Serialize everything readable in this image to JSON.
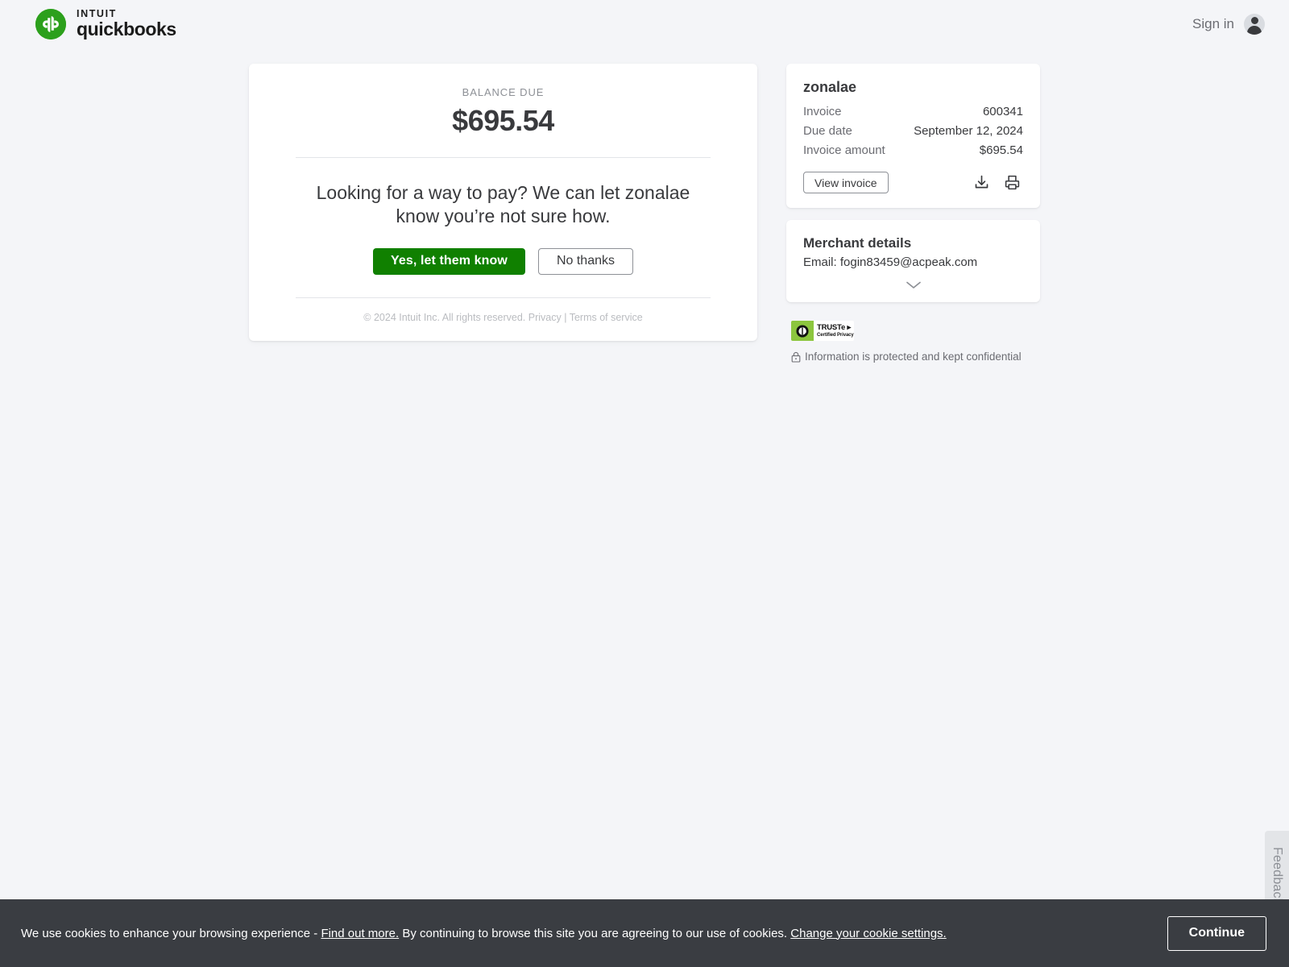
{
  "header": {
    "brand_intuit": "INTUIT",
    "brand_product": "quickbooks",
    "signin_label": "Sign in"
  },
  "main": {
    "balance_label": "BALANCE DUE",
    "balance_amount": "$695.54",
    "prompt": "Looking for a way to pay? We can let zonalae know you’re not sure how.",
    "primary_button": "Yes, let them know",
    "secondary_button": "No thanks",
    "legal_copyright": "© 2024 Intuit Inc. All rights reserved. ",
    "legal_privacy": "Privacy",
    "legal_separator": " | ",
    "legal_terms": "Terms of service"
  },
  "invoice_card": {
    "merchant_name": "zonalae",
    "rows": [
      {
        "label": "Invoice",
        "value": "600341"
      },
      {
        "label": "Due date",
        "value": "September 12, 2024"
      },
      {
        "label": "Invoice amount",
        "value": "$695.54"
      }
    ],
    "view_invoice_label": "View invoice",
    "download_icon": "download-icon",
    "print_icon": "printer-icon"
  },
  "merchant_card": {
    "title": "Merchant details",
    "email_line": "Email: fogin83459@acpeak.com",
    "expand_icon": "chevron-down-icon"
  },
  "trust": {
    "badge_main": "TRUSTe ▸",
    "badge_sub": "Certified Privacy",
    "protected_text": "Information is protected and kept confidential",
    "lock_icon": "lock-icon"
  },
  "feedback": {
    "label": "Feedback"
  },
  "cookie_banner": {
    "text_1": "We use cookies to enhance your browsing experience - ",
    "link_1": "Find out more.",
    "text_2": " By continuing to browse this site you are agreeing to our use of cookies. ",
    "link_2": "Change your cookie settings.",
    "continue_label": "Continue"
  },
  "colors": {
    "page_background": "#f4f5f8",
    "brand_green": "#2ca01c",
    "primary_button_green": "#108000",
    "text_dark": "#393a3d",
    "text_muted": "#6b6c72",
    "cookie_bar": "#3a3d42"
  }
}
